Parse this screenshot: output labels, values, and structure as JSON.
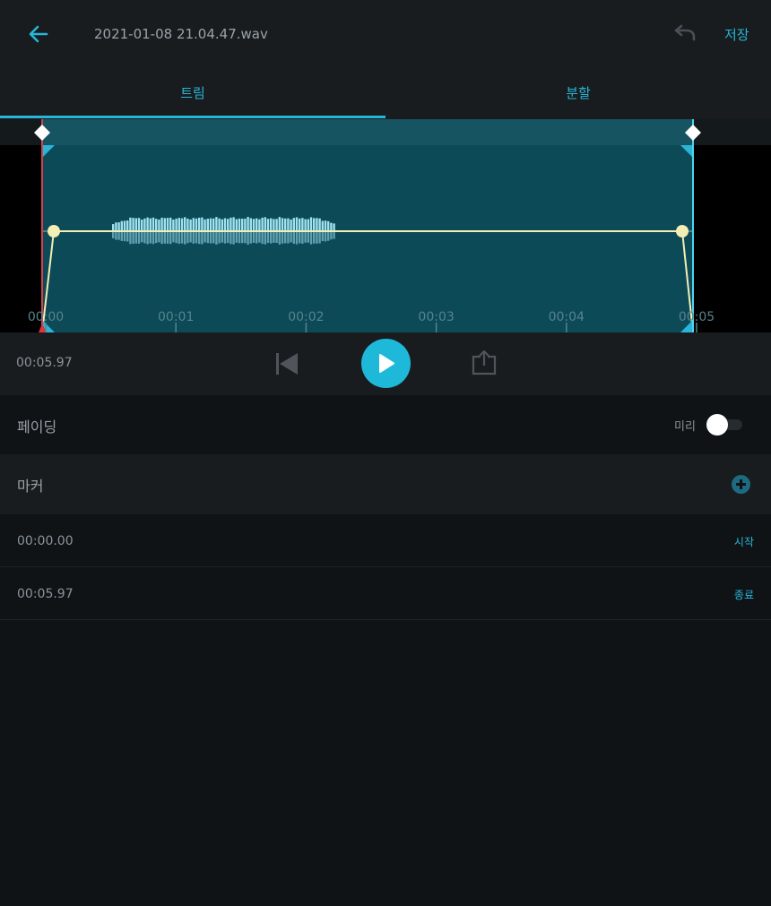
{
  "header": {
    "title": "2021-01-08 21.04.47.wav",
    "save_label": "저장"
  },
  "tabs": [
    {
      "label": "트림",
      "active": true
    },
    {
      "label": "분할",
      "active": false
    }
  ],
  "timeline": {
    "ticks": [
      "00:00",
      "00:01",
      "00:02",
      "00:03",
      "00:04",
      "00:05"
    ]
  },
  "player": {
    "duration": "00:05.97"
  },
  "fading": {
    "label": "페이딩",
    "preview_label": "미리",
    "preview_on": false
  },
  "markers": {
    "label": "마커",
    "items": [
      {
        "time": "00:00.00",
        "tag": "시작"
      },
      {
        "time": "00:05.97",
        "tag": "종료"
      }
    ]
  },
  "colors": {
    "accent": "#28b5d8",
    "selection": "#0d4a58",
    "waveform": "#7fd3e6",
    "fade_line": "#f3efb4"
  }
}
